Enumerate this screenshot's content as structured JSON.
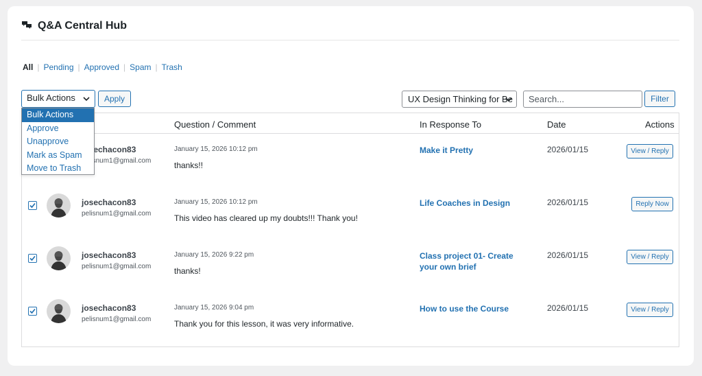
{
  "header": {
    "title": "Q&A Central Hub",
    "icon": "comments-icon"
  },
  "filters": {
    "all": "All",
    "items": [
      "Pending",
      "Approved",
      "Spam",
      "Trash"
    ]
  },
  "toolbar": {
    "bulk_actions": "Bulk Actions",
    "apply": "Apply",
    "course_select": "UX Design Thinking for Be",
    "search_placeholder": "Search...",
    "filter": "Filter"
  },
  "bulk_menu": {
    "options": [
      "Bulk Actions",
      "Approve",
      "Unapprove",
      "Mark as Spam",
      "Move to Trash"
    ],
    "selected": "Bulk Actions"
  },
  "table": {
    "columns": {
      "question": "Question / Comment",
      "response": "In Response To",
      "date": "Date",
      "actions": "Actions"
    },
    "rows": [
      {
        "checked": true,
        "username": "josechacon83",
        "email": "pelisnum1@gmail.com",
        "posted": "January 15, 2026 10:12 pm",
        "comment": "thanks!!",
        "course": "Make it Pretty",
        "date": "2026/01/15",
        "action": "View / Reply"
      },
      {
        "checked": true,
        "username": "josechacon83",
        "email": "pelisnum1@gmail.com",
        "posted": "January 15, 2026 10:12 pm",
        "comment": "This video has cleared up my doubts!!! Thank you!",
        "course": "Life Coaches in Design",
        "date": "2026/01/15",
        "action": "Reply Now"
      },
      {
        "checked": true,
        "username": "josechacon83",
        "email": "pelisnum1@gmail.com",
        "posted": "January 15, 2026 9:22 pm",
        "comment": "thanks!",
        "course": "Class project 01- Create your own brief",
        "date": "2026/01/15",
        "action": "View / Reply"
      },
      {
        "checked": true,
        "username": "josechacon83",
        "email": "pelisnum1@gmail.com",
        "posted": "January 15, 2026 9:04 pm",
        "comment": "Thank you for this lesson, it was very informative.",
        "course": "How to use the Course",
        "date": "2026/01/15",
        "action": "View / Reply"
      }
    ]
  },
  "colors": {
    "accent": "#2271b1",
    "background": "#f0f0f1",
    "text": "#1d2327"
  }
}
